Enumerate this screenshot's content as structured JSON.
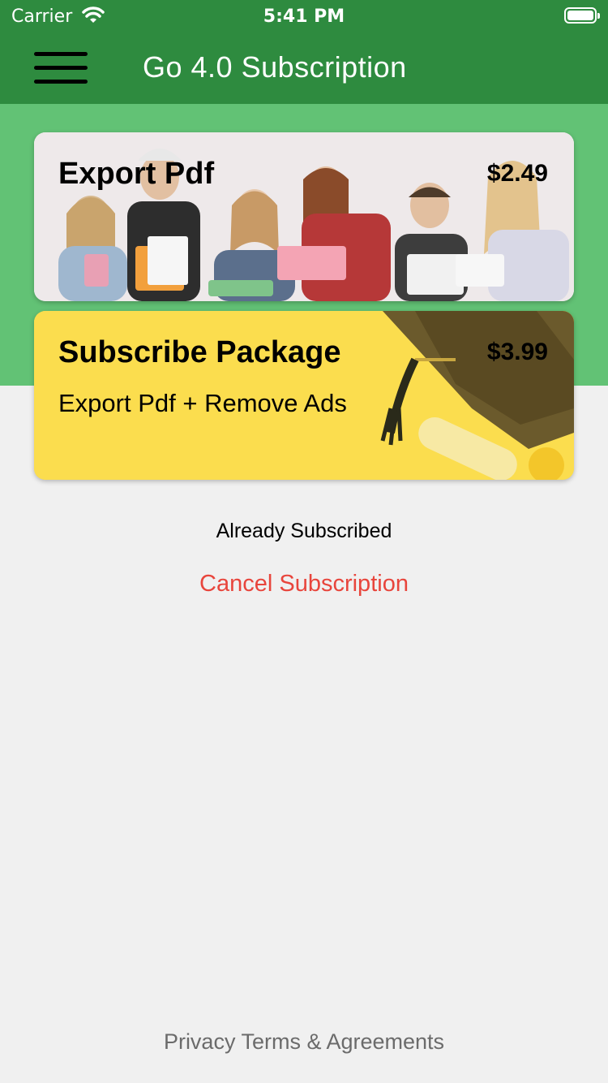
{
  "status_bar": {
    "carrier": "Carrier",
    "time": "5:41 PM"
  },
  "nav": {
    "title": "Go 4.0 Subscription"
  },
  "cards": {
    "export": {
      "title": "Export Pdf",
      "price": "$2.49"
    },
    "subscribe": {
      "title": "Subscribe Package",
      "subtitle": "Export Pdf + Remove Ads",
      "price": "$3.99"
    }
  },
  "already_subscribed": "Already Subscribed",
  "cancel_subscription": "Cancel Subscription",
  "privacy_link": "Privacy Terms & Agreements",
  "colors": {
    "nav_green": "#2e8b3f",
    "band_green": "#62c275",
    "card_yellow": "#fbdd4e",
    "cancel_red": "#e8453c",
    "background": "#f0f0f0"
  },
  "icons": [
    "wifi-icon",
    "battery-icon",
    "menu-icon"
  ]
}
